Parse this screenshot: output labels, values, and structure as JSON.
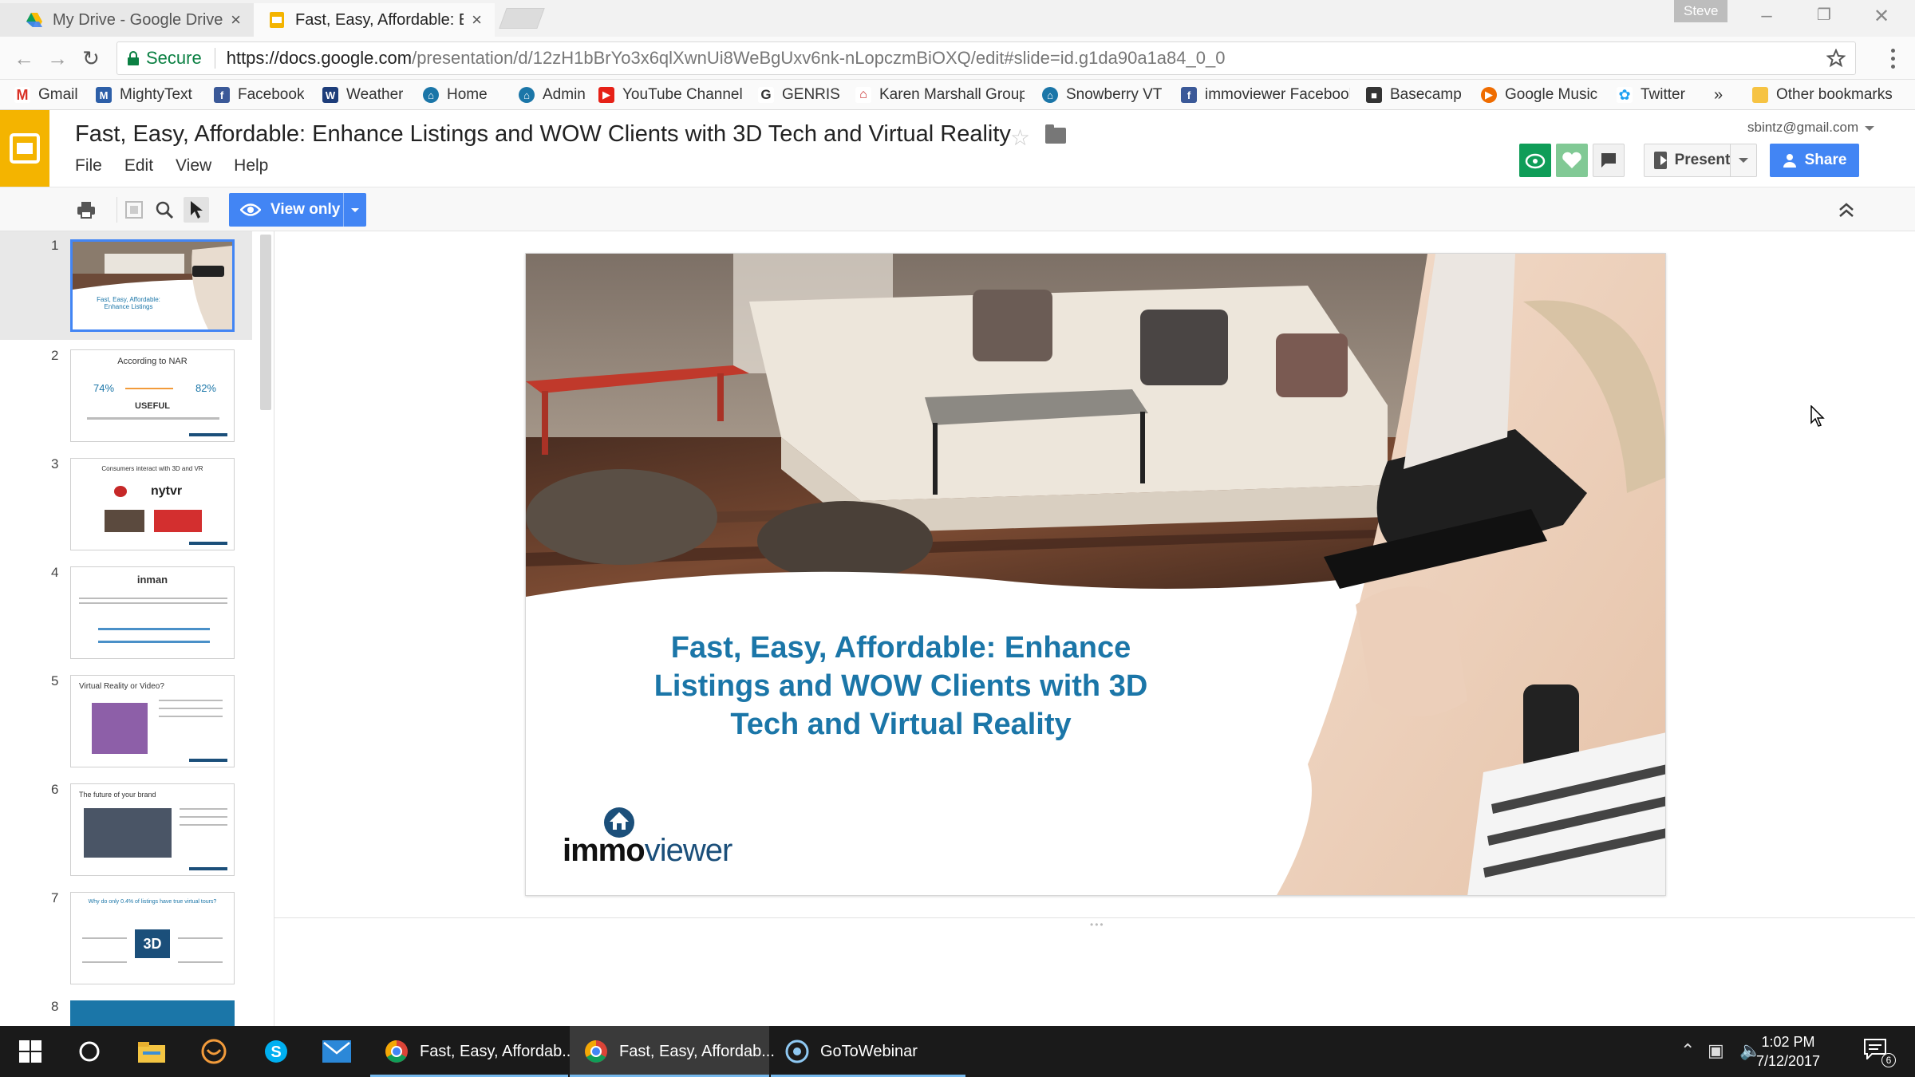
{
  "browser": {
    "tabs": [
      {
        "title": "My Drive - Google Drive",
        "close": "×"
      },
      {
        "title": "Fast, Easy, Affordable: En",
        "close": "×"
      }
    ],
    "profile": "Steve",
    "url": {
      "secure_label": "Secure",
      "host": "https://docs.google.com",
      "path": "/presentation/d/12zH1bBrYo3x6qlXwnUi8WeBgUxv6nk-nLopczmBiOXQ/edit#slide=id.g1da90a1a84_0_0"
    },
    "bookmarks": [
      {
        "label": "Gmail"
      },
      {
        "label": "MightyText"
      },
      {
        "label": "Facebook"
      },
      {
        "label": "Weather"
      },
      {
        "label": "Home"
      },
      {
        "label": "Admin"
      },
      {
        "label": "YouTube Channel"
      },
      {
        "label": "GENRIS"
      },
      {
        "label": "Karen Marshall Group"
      },
      {
        "label": "Snowberry VT"
      },
      {
        "label": "immoviewer Facebook"
      },
      {
        "label": "Basecamp"
      },
      {
        "label": "Google Music"
      },
      {
        "label": "Twitter"
      }
    ],
    "bookmarks_more": "»",
    "other_bookmarks": "Other bookmarks"
  },
  "app": {
    "doc_title": "Fast, Easy, Affordable: Enhance Listings and WOW Clients with 3D Tech and Virtual Reality",
    "menu": [
      "File",
      "Edit",
      "View",
      "Help"
    ],
    "account": "sbintz@gmail.com",
    "present_label": "Present",
    "share_label": "Share",
    "view_only_label": "View only"
  },
  "filmstrip": {
    "slides": [
      {
        "num": "1",
        "caption": "Fast, Easy, Affordable: Enhance Listings"
      },
      {
        "num": "2",
        "caption": "According to NAR"
      },
      {
        "num": "3",
        "caption": "Consumers interact with 3D and VR"
      },
      {
        "num": "4",
        "caption": "inman"
      },
      {
        "num": "5",
        "caption": "Virtual Reality or Video?"
      },
      {
        "num": "6",
        "caption": "The future of your brand"
      },
      {
        "num": "7",
        "caption": "Why do only 0.4% of listings have true virtual tours?"
      },
      {
        "num": "8",
        "caption": ""
      }
    ],
    "slide2_values": {
      "left": "74%",
      "right": "82%",
      "word": "USEFUL"
    }
  },
  "slide": {
    "title": "Fast, Easy, Affordable: Enhance Listings and WOW Clients with 3D Tech and Virtual Reality",
    "logo_text_a": "immo",
    "logo_text_b": "viewer",
    "colors": {
      "title": "#1b76a8",
      "brand_dark": "#1b4f7a"
    }
  },
  "taskbar": {
    "apps": [
      {
        "label": "Fast, Easy, Affordab..."
      },
      {
        "label": "Fast, Easy, Affordab..."
      },
      {
        "label": "GoToWebinar"
      }
    ],
    "time": "1:02 PM",
    "date": "7/12/2017",
    "notification_count": "6"
  },
  "colors": {
    "accent": "#4285f4",
    "slides_yellow": "#f4b400",
    "secure_green": "#0b8043"
  }
}
